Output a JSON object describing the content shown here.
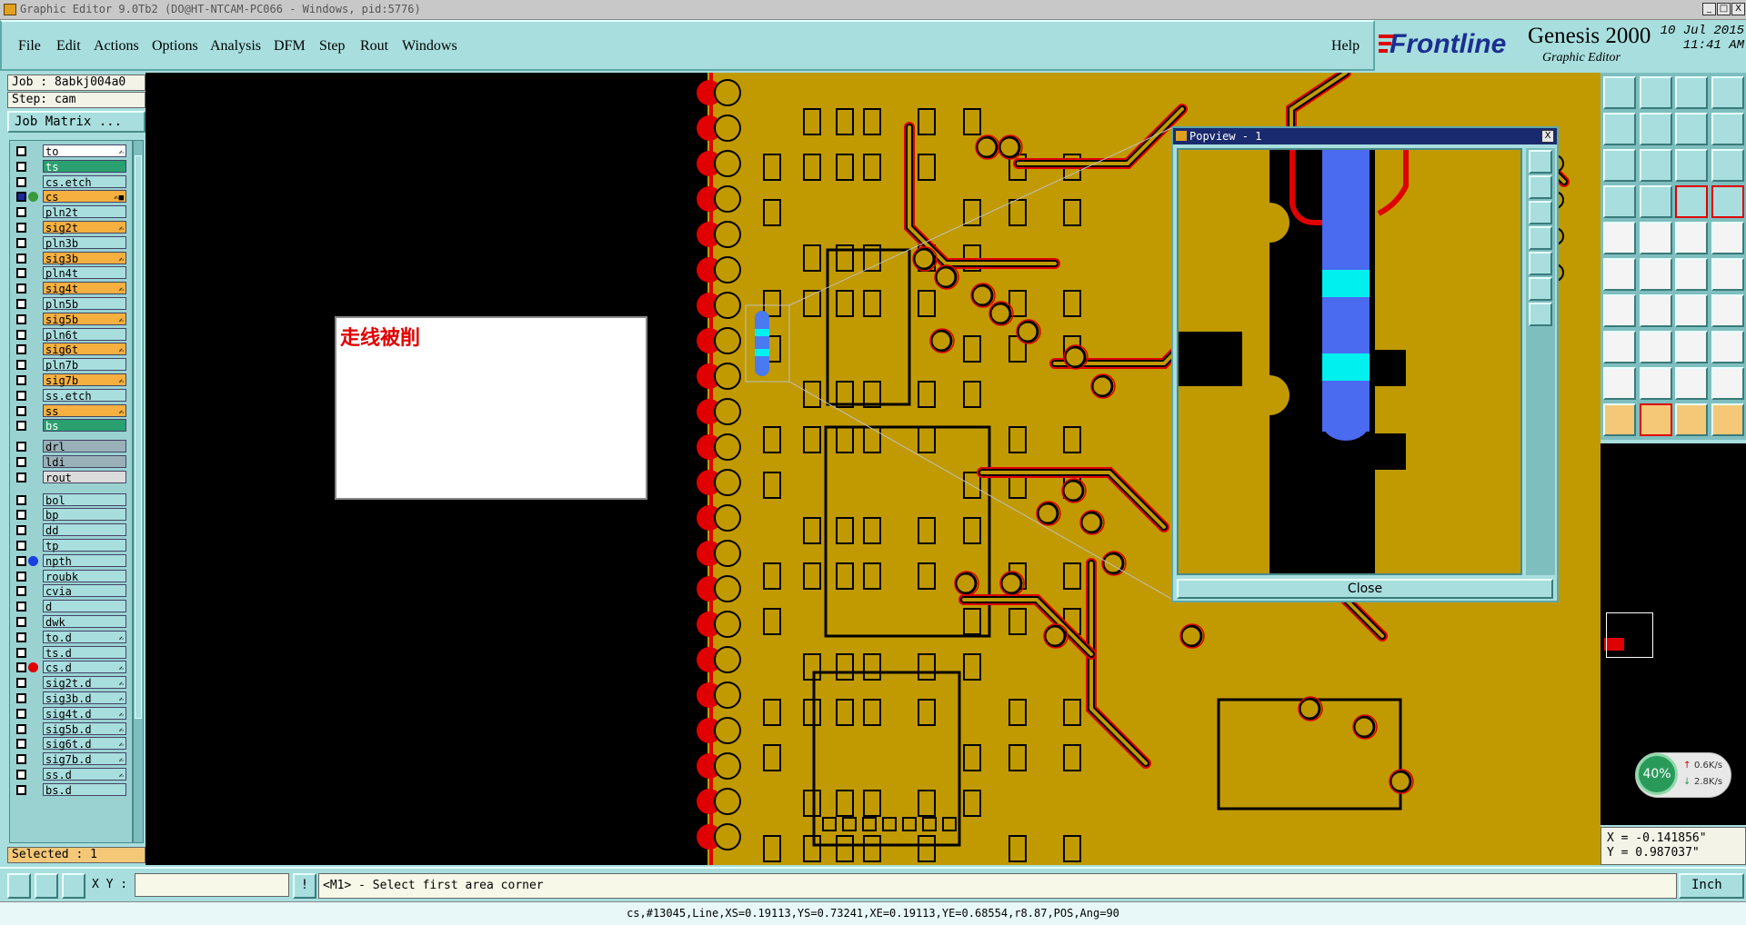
{
  "window": {
    "title": "Graphic Editor 9.0Tb2 (DO@HT-NTCAM-PC066 - Windows, pid:5776)",
    "controls": [
      "_",
      "□",
      "X"
    ]
  },
  "menu": {
    "items": [
      "File",
      "Edit",
      "Actions",
      "Options",
      "Analysis",
      "DFM",
      "Step",
      "Rout",
      "Windows"
    ],
    "help": "Help"
  },
  "brand": {
    "logo": "Frontline",
    "product": "Genesis 2000",
    "subtitle": "Graphic Editor",
    "date": "10 Jul 2015",
    "time": "11:41 AM"
  },
  "job": {
    "job_label": "Job : 8abkj004a0",
    "step_label": "Step: cam",
    "matrix_button": "Job Matrix ..."
  },
  "layers": [
    {
      "name": "to",
      "bg": "#ffffff",
      "flag": "✍"
    },
    {
      "name": "ts",
      "bg": "#2aa070",
      "flag": ""
    },
    {
      "name": "cs.etch",
      "bg": "#a8dede",
      "flag": ""
    },
    {
      "name": "cs",
      "bg": "#f5b040",
      "flag": "✍■",
      "active": true,
      "dot": "#3a9a3a"
    },
    {
      "name": "pln2t",
      "bg": "#a8dede",
      "flag": ""
    },
    {
      "name": "sig2t",
      "bg": "#f5b040",
      "flag": "✍"
    },
    {
      "name": "pln3b",
      "bg": "#a8dede",
      "flag": ""
    },
    {
      "name": "sig3b",
      "bg": "#f5b040",
      "flag": "✍"
    },
    {
      "name": "pln4t",
      "bg": "#a8dede",
      "flag": ""
    },
    {
      "name": "sig4t",
      "bg": "#f5b040",
      "flag": "✍"
    },
    {
      "name": "pln5b",
      "bg": "#a8dede",
      "flag": ""
    },
    {
      "name": "sig5b",
      "bg": "#f5b040",
      "flag": "✍"
    },
    {
      "name": "pln6t",
      "bg": "#a8dede",
      "flag": ""
    },
    {
      "name": "sig6t",
      "bg": "#f5b040",
      "flag": "✍"
    },
    {
      "name": "pln7b",
      "bg": "#a8dede",
      "flag": ""
    },
    {
      "name": "sig7b",
      "bg": "#f5b040",
      "flag": "✍"
    },
    {
      "name": "ss.etch",
      "bg": "#a8dede",
      "flag": ""
    },
    {
      "name": "ss",
      "bg": "#f5b040",
      "flag": "✍"
    },
    {
      "name": "bs",
      "bg": "#2aa070",
      "flag": ""
    },
    {
      "name": "drl",
      "bg": "#9ab0b8",
      "flag": ""
    },
    {
      "name": "ldi",
      "bg": "#9ab0b8",
      "flag": ""
    },
    {
      "name": "rout",
      "bg": "#dcdcdc",
      "flag": ""
    },
    {
      "name": "bol",
      "bg": "#a8dede",
      "flag": ""
    },
    {
      "name": "bp",
      "bg": "#a8dede",
      "flag": ""
    },
    {
      "name": "dd",
      "bg": "#a8dede",
      "flag": ""
    },
    {
      "name": "tp",
      "bg": "#a8dede",
      "flag": ""
    },
    {
      "name": "npth",
      "bg": "#a8dede",
      "flag": "",
      "dot": "#1a40e0"
    },
    {
      "name": "roubk",
      "bg": "#a8dede",
      "flag": ""
    },
    {
      "name": "cvia",
      "bg": "#a8dede",
      "flag": ""
    },
    {
      "name": "d",
      "bg": "#a8dede",
      "flag": ""
    },
    {
      "name": "dwk",
      "bg": "#a8dede",
      "flag": ""
    },
    {
      "name": "to.d",
      "bg": "#a8dede",
      "flag": "✍"
    },
    {
      "name": "ts.d",
      "bg": "#a8dede",
      "flag": ""
    },
    {
      "name": "cs.d",
      "bg": "#a8dede",
      "flag": "✍",
      "dot": "#e00000"
    },
    {
      "name": "sig2t.d",
      "bg": "#a8dede",
      "flag": "✍"
    },
    {
      "name": "sig3b.d",
      "bg": "#a8dede",
      "flag": "✍"
    },
    {
      "name": "sig4t.d",
      "bg": "#a8dede",
      "flag": "✍"
    },
    {
      "name": "sig5b.d",
      "bg": "#a8dede",
      "flag": "✍"
    },
    {
      "name": "sig6t.d",
      "bg": "#a8dede",
      "flag": "✍"
    },
    {
      "name": "sig7b.d",
      "bg": "#a8dede",
      "flag": "✍"
    },
    {
      "name": "ss.d",
      "bg": "#a8dede",
      "flag": "✍"
    },
    {
      "name": "bs.d",
      "bg": "#a8dede",
      "flag": ""
    }
  ],
  "selected_label": "Selected : 1",
  "canvas": {
    "note": "走线被削",
    "colors": {
      "copper": "#c09a00",
      "outline": "#e00000",
      "background": "#000000",
      "highlight": "#4a7af0",
      "cyan": "#00f0f0"
    }
  },
  "popview": {
    "title": "Popview - 1",
    "close_label": "Close"
  },
  "network": {
    "percent": "40%",
    "up": "0.6K/s",
    "down": "2.8K/s"
  },
  "coords": {
    "x": "X = -0.141856\"",
    "y": "Y = 0.987037\""
  },
  "command": {
    "xy_label": "X Y :",
    "xy_value": "",
    "prompt": "<M1> - Select first area corner",
    "unit": "Inch"
  },
  "status": "cs,#13045,Line,XS=0.19113,YS=0.73241,XE=0.19113,YE=0.68554,r8.87,POS,Ang=90"
}
